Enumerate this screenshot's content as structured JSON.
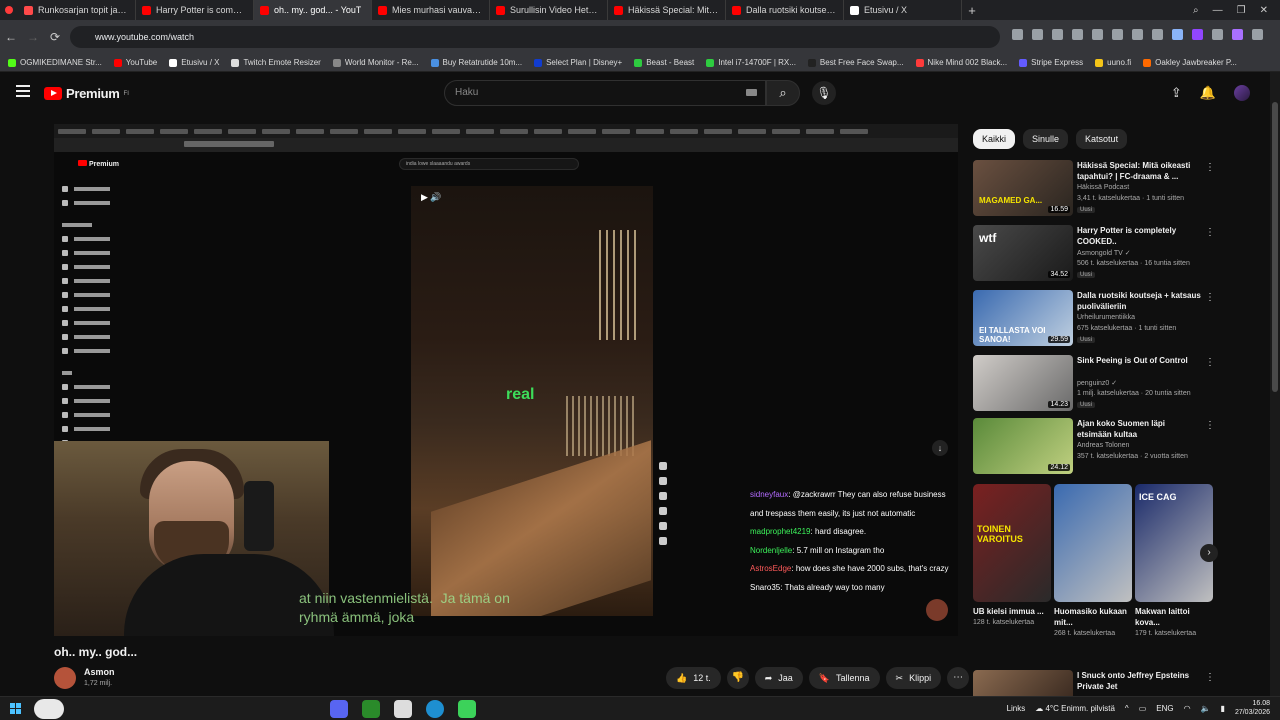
{
  "browser": {
    "tabs": [
      {
        "label": "Runkosarjan topit ja flopit",
        "color": "#ff4a4a"
      },
      {
        "label": "Harry Potter is completely",
        "color": "#ff0000"
      },
      {
        "label": "oh.. my.. god... - YouT",
        "color": "#ff0000",
        "active": true
      },
      {
        "label": "Mies murhasi vauvansa ja",
        "color": "#ff0000"
      },
      {
        "label": "Surullisin Video Hetkeen",
        "color": "#ff0000"
      },
      {
        "label": "Häkissä Special: Mitä oike",
        "color": "#ff0000"
      },
      {
        "label": "Dalla ruotsiki koutseja + ka",
        "color": "#ff0000"
      },
      {
        "label": "Etusivu / X",
        "color": "#ffffff"
      }
    ],
    "url": "www.youtube.com/watch",
    "bookmarks": [
      {
        "label": "OGMIKEDIMANE Str...",
        "color": "#53fc18"
      },
      {
        "label": "YouTube",
        "color": "#ff0000"
      },
      {
        "label": "Etusivu / X",
        "color": "#ffffff"
      },
      {
        "label": "Twitch Emote Resizer",
        "color": "#dddddd"
      },
      {
        "label": "World Monitor - Re...",
        "color": "#888888"
      },
      {
        "label": "Buy Retatrutide 10m...",
        "color": "#4a90e2"
      },
      {
        "label": "Select Plan | Disney+",
        "color": "#113ccf"
      },
      {
        "label": "Beast - Beast",
        "color": "#2ecc40"
      },
      {
        "label": "Intel i7-14700F | RX...",
        "color": "#2ecc40"
      },
      {
        "label": "Best Free Face Swap...",
        "color": "#222222"
      },
      {
        "label": "Nike Mind 002 Black...",
        "color": "#ff3b3b"
      },
      {
        "label": "Stripe Express",
        "color": "#635bff"
      },
      {
        "label": "uuno.fi",
        "color": "#f5c518"
      },
      {
        "label": "Oakley Jawbreaker P...",
        "color": "#ff6a00"
      }
    ]
  },
  "youtube": {
    "logo": "Premium",
    "logo_sup": "FI",
    "search_placeholder": "Haku"
  },
  "player": {
    "inner_logo": "Premium",
    "inner_search": "india lowe slaaaandu awards",
    "real_text": "real",
    "subtitle": "at niin vastenmielistä.  Ja tämä on\nryhmä ämmä, joka",
    "chat": [
      {
        "user": "sidneyfaux",
        "cls": "u1",
        "msg": " @zackrawrr They can also refuse business and trespass them easily, its just not automatic"
      },
      {
        "user": "madprophet4219",
        "cls": "u3",
        "msg": " hard disagree."
      },
      {
        "user": "Nordenljelle",
        "cls": "u3",
        "msg": " 5.7 mill on Instagram tho"
      },
      {
        "user": "AstrosEdge",
        "cls": "u4",
        "msg": " how does she have 2000 subs, that's crazy"
      },
      {
        "user": "Snaro35",
        "cls": "u5",
        "msg": " Thats already way too many"
      }
    ]
  },
  "video": {
    "title": "oh.. my.. god...",
    "channel": "Asmon",
    "subs": "1,72 milj.",
    "likes": "12 t.",
    "share": "Jaa",
    "save": "Tallenna",
    "clip": "Klippi"
  },
  "right": {
    "chips": [
      "Kaikki",
      "Sinulle",
      "Katsotut"
    ],
    "recs": [
      {
        "title": "Häkissä Special: Mitä oikeasti tapahtui? | FC-draama & ...",
        "channel": "Häkissä Podcast",
        "meta": "3,41 t. katselukertaa · 1 tunti sitten",
        "badge": "Uusi",
        "dur": "16.59",
        "thumb_text": "MAGAMED GA..."
      },
      {
        "title": "Harry Potter is completely COOKED..",
        "channel": "Asmongold TV ✓",
        "meta": "506 t. katselukertaa · 16 tuntia sitten",
        "badge": "Uusi",
        "dur": "34.52",
        "thumb_text": "wtf"
      },
      {
        "title": "Dalla ruotsiki koutseja + katsaus puolivälieriin",
        "channel": "Urheilurumentiikka",
        "meta": "675 katselukertaa · 1 tunti sitten",
        "badge": "Uusi",
        "dur": "29.59",
        "thumb_text": "EI TALLASTA VOI SANOA!"
      },
      {
        "title": "Sink Peeing is Out of Control",
        "channel": "penguinz0 ✓",
        "meta": "1 milj. katselukertaa · 20 tuntia sitten",
        "badge": "Uusi",
        "dur": "14.23",
        "thumb_text": ""
      },
      {
        "title": "Ajan koko Suomen läpi etsimään kultaa",
        "channel": "Andreas Tolonen",
        "meta": "357 t. katselukertaa · 2 vuotta sitten",
        "badge": "",
        "dur": "24.12",
        "thumb_text": ""
      }
    ],
    "shorts": [
      {
        "title": "UB kielsi immua ...",
        "views": "128 t. katselukertaa",
        "thumb_text": "TOINEN VAROITUS"
      },
      {
        "title": "Huomasiko kukaan mit...",
        "views": "268 t. katselukertaa",
        "thumb_text": ""
      },
      {
        "title": "Makwan laittoi kova...",
        "views": "179 t. katselukertaa",
        "thumb_text": "ICE CAG"
      }
    ],
    "last_rec_title": "I Snuck onto Jeffrey Epsteins Private Jet"
  },
  "taskbar": {
    "links": "Links",
    "weather": "4°C  Enimm. pilvistä",
    "lang": "ENG",
    "time": "16.08",
    "date": "27/03/2026"
  }
}
